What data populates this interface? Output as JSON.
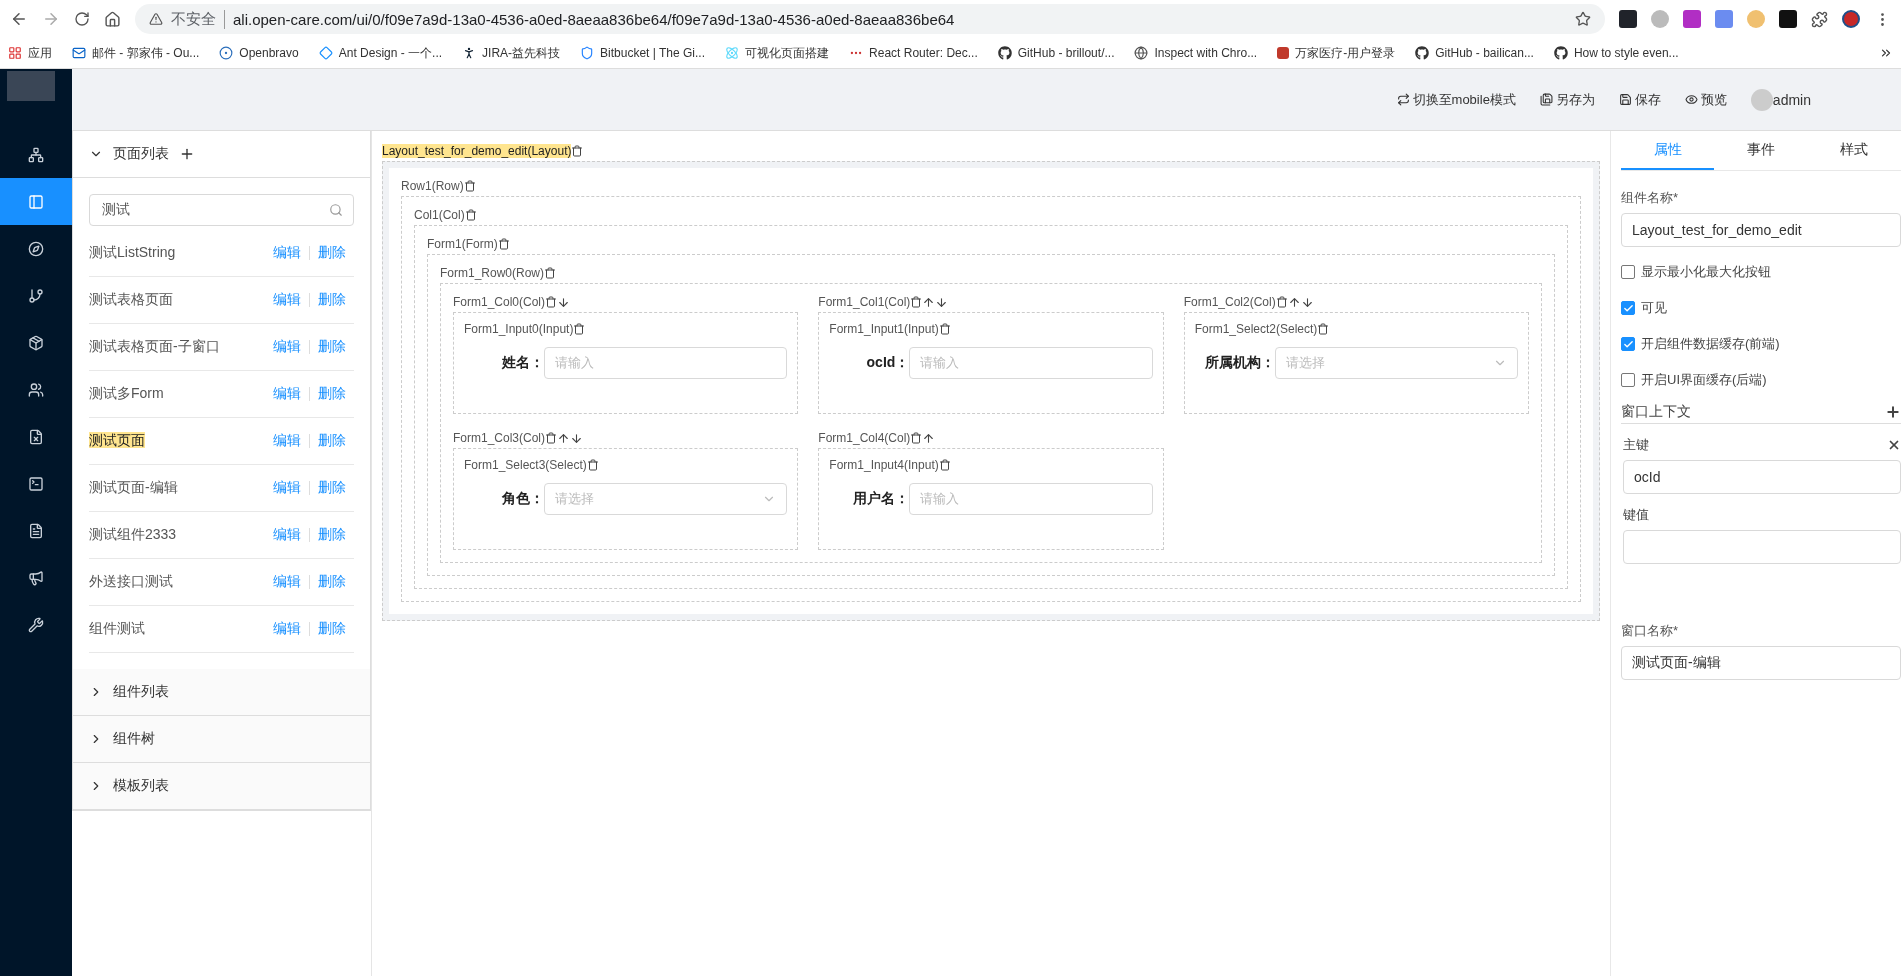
{
  "browser": {
    "security": "不安全",
    "url": "ali.open-care.com/ui/0/f09e7a9d-13a0-4536-a0ed-8aeaa836be64/f09e7a9d-13a0-4536-a0ed-8aeaa836be64",
    "bookmarks": [
      {
        "kind": "grid",
        "label": "应用"
      },
      {
        "kind": "mail",
        "label": "邮件 - 郭家伟 - Ou..."
      },
      {
        "kind": "ring",
        "label": "Openbravo"
      },
      {
        "kind": "diamond",
        "label": "Ant Design - 一个..."
      },
      {
        "kind": "figure",
        "label": "JIRA-益先科技"
      },
      {
        "kind": "shield",
        "label": "Bitbucket | The Gi..."
      },
      {
        "kind": "atom",
        "label": "可视化页面搭建"
      },
      {
        "kind": "dots",
        "label": "React Router: Dec..."
      },
      {
        "kind": "github",
        "label": "GitHub - brillout/..."
      },
      {
        "kind": "globe",
        "label": "Inspect with Chro..."
      },
      {
        "kind": "letter",
        "label": "万家医疗-用户登录"
      },
      {
        "kind": "github",
        "label": "GitHub - bailican..."
      },
      {
        "kind": "github",
        "label": "How to style even..."
      }
    ]
  },
  "nav": {
    "items": [
      {
        "selected": false
      },
      {
        "selected": true
      },
      {
        "selected": false
      },
      {
        "selected": false
      },
      {
        "selected": false
      },
      {
        "selected": false
      },
      {
        "selected": false
      },
      {
        "selected": false
      },
      {
        "selected": false
      },
      {
        "selected": false
      },
      {
        "selected": false
      }
    ]
  },
  "header": {
    "actions": [
      {
        "kind": "switch",
        "label": "切换至mobile模式"
      },
      {
        "kind": "save-as",
        "label": "另存为"
      },
      {
        "kind": "save",
        "label": "保存"
      },
      {
        "kind": "preview",
        "label": "预览"
      }
    ],
    "user": "admin"
  },
  "page_list": {
    "title": "页面列表",
    "expanded": true,
    "search": "测试",
    "items": [
      {
        "name": "测试ListString",
        "highlighted": false,
        "edit": "编辑",
        "delete": "删除"
      },
      {
        "name": "测试表格页面",
        "highlighted": false,
        "edit": "编辑",
        "delete": "删除"
      },
      {
        "name": "测试表格页面-子窗口",
        "highlighted": false,
        "edit": "编辑",
        "delete": "删除"
      },
      {
        "name": "测试多Form",
        "highlighted": false,
        "edit": "编辑",
        "delete": "删除"
      },
      {
        "name": "测试页面",
        "highlighted": true,
        "edit": "编辑",
        "delete": "删除"
      },
      {
        "name": "测试页面-编辑",
        "highlighted": false,
        "edit": "编辑",
        "delete": "删除"
      },
      {
        "name": "测试组件2333",
        "highlighted": false,
        "edit": "编辑",
        "delete": "删除"
      },
      {
        "name": "外送接口测试",
        "highlighted": false,
        "edit": "编辑",
        "delete": "删除"
      },
      {
        "name": "组件测试",
        "highlighted": false,
        "edit": "编辑",
        "delete": "删除"
      }
    ],
    "sections": [
      {
        "title": "组件列表",
        "expanded": false
      },
      {
        "title": "组件树",
        "expanded": false
      },
      {
        "title": "模板列表",
        "expanded": false
      }
    ]
  },
  "canvas": {
    "root": {
      "label": "Layout_test_for_demo_edit(Layout)",
      "highlighted": true,
      "children": [
        {
          "label": "Row1(Row)",
          "highlighted": false,
          "children": [
            {
              "label": "Col1(Col)",
              "highlighted": false,
              "children": [
                {
                  "label": "Form1(Form)",
                  "highlighted": false,
                  "children": [
                    {
                      "label": "Form1_Row0(Row)",
                      "highlighted": false,
                      "columns": [
                        {
                          "label": "Form1_Col0(Col)",
                          "move_up": false,
                          "move_down": true,
                          "item": {
                            "label": "Form1_Input0(Input)",
                            "field_label": "姓名：",
                            "kind": "input",
                            "placeholder": "请输入"
                          }
                        },
                        {
                          "label": "Form1_Col1(Col)",
                          "move_up": true,
                          "move_down": true,
                          "item": {
                            "label": "Form1_Input1(Input)",
                            "field_label": "ocId：",
                            "kind": "input",
                            "placeholder": "请输入"
                          }
                        },
                        {
                          "label": "Form1_Col2(Col)",
                          "move_up": true,
                          "move_down": true,
                          "item": {
                            "label": "Form1_Select2(Select)",
                            "field_label": "所属机构：",
                            "kind": "select",
                            "placeholder": "请选择"
                          }
                        },
                        {
                          "label": "Form1_Col3(Col)",
                          "move_up": true,
                          "move_down": true,
                          "item": {
                            "label": "Form1_Select3(Select)",
                            "field_label": "角色：",
                            "kind": "select",
                            "placeholder": "请选择"
                          }
                        },
                        {
                          "label": "Form1_Col4(Col)",
                          "move_up": true,
                          "move_down": false,
                          "item": {
                            "label": "Form1_Input4(Input)",
                            "field_label": "用户名：",
                            "kind": "input",
                            "placeholder": "请输入"
                          }
                        }
                      ]
                    }
                  ]
                }
              ]
            }
          ]
        }
      ]
    }
  },
  "properties": {
    "tabs": [
      {
        "label": "属性",
        "selected": true
      },
      {
        "label": "事件",
        "selected": false
      },
      {
        "label": "样式",
        "selected": false
      }
    ],
    "name_label": "组件名称*",
    "name_value": "Layout_test_for_demo_edit",
    "checkboxes": [
      {
        "label": "显示最小化最大化按钮",
        "checked": false
      },
      {
        "label": "可见",
        "checked": true
      },
      {
        "label": "开启组件数据缓存(前端)",
        "checked": true
      },
      {
        "label": "开启UI界面缓存(后端)",
        "checked": false
      }
    ],
    "context_title": "窗口上下文",
    "context": {
      "key_label": "主键",
      "key_value": "ocId",
      "value_label": "键值"
    },
    "window_name_label": "窗口名称*",
    "window_name_value": "测试页面-编辑"
  }
}
